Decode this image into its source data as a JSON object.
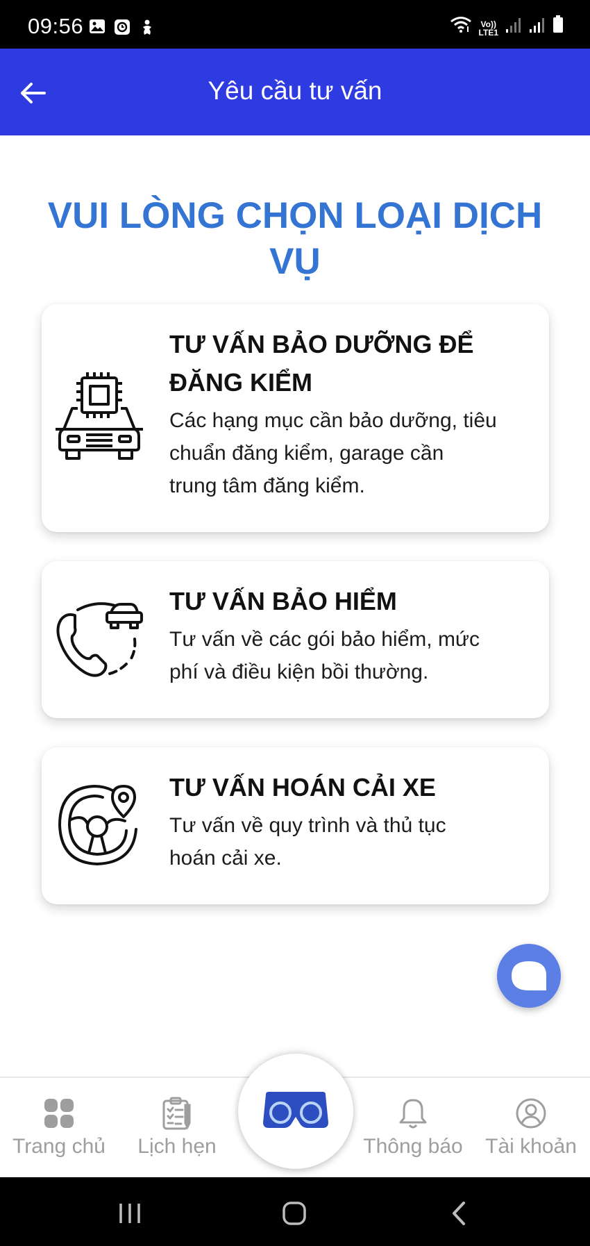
{
  "status_bar": {
    "time": "09:56",
    "left_icons": [
      "gallery-icon",
      "clock-app-icon",
      "accessibility-icon"
    ],
    "right_icons": [
      "wifi-icon",
      "volte-icon",
      "signal-icon",
      "signal-icon",
      "battery-icon"
    ],
    "volte_label_top": "Vo))",
    "volte_label_bottom": "LTE1"
  },
  "header": {
    "title": "Yêu cầu tư vấn",
    "back_icon": "arrow-left-icon",
    "background": "#2d3be0"
  },
  "heading": {
    "line1": "VUI LÒNG CHỌN LOẠI DỊCH",
    "line2": "VỤ",
    "color": "#3474d3"
  },
  "services": [
    {
      "title_line1": "TƯ VẤN BẢO DƯỠNG ĐỂ",
      "title_line2": "ĐĂNG KIỂM",
      "desc_line1": "Các hạng mục cần bảo dưỡng, tiêu",
      "desc_line2": "chuẩn đăng kiểm, garage cần",
      "desc_line3": "trung tâm đăng kiểm.",
      "icon": "car-chip-icon"
    },
    {
      "title_line1": "TƯ VẤN BẢO HIỂM",
      "desc_line1": "Tư vấn về các gói bảo hiểm, mức",
      "desc_line2": "phí và điều kiện bồi thường.",
      "icon": "phone-car-icon"
    },
    {
      "title_line1": "TƯ VẤN HOÁN CẢI XE",
      "desc_line1": "Tư vấn về quy trình và thủ tục",
      "desc_line2": "hoán cải xe.",
      "icon": "steering-wheel-location-icon"
    }
  ],
  "fab": {
    "icon": "chat-bubble-icon",
    "color": "#5c7fe6"
  },
  "bottom_nav": {
    "items": [
      {
        "label": "Trang chủ",
        "icon": "home-grid-icon"
      },
      {
        "label": "Lịch hẹn",
        "icon": "clipboard-icon"
      },
      {
        "label": "",
        "icon": "vr-headset-icon"
      },
      {
        "label": "Thông báo",
        "icon": "bell-icon"
      },
      {
        "label": "Tài khoản",
        "icon": "user-circle-icon"
      }
    ]
  },
  "system_nav": [
    "recent-apps-icon",
    "home-icon",
    "back-icon"
  ]
}
